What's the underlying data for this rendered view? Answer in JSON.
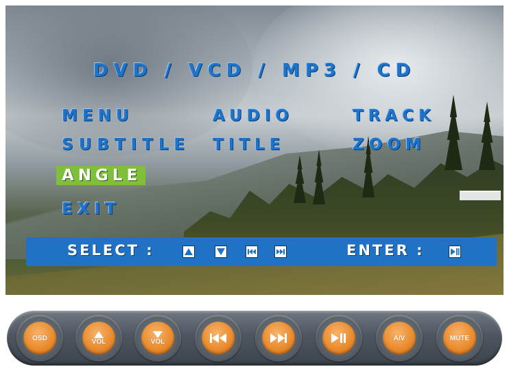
{
  "osd": {
    "title": "DVD / VCD / MP3 / CD",
    "items": {
      "menu": "MENU",
      "audio": "AUDIO",
      "track": "TRACK",
      "subtitle": "SUBTITLE",
      "title": "TITLE",
      "zoom": "ZOOM",
      "angle": "ANGLE",
      "exit": "EXIT"
    },
    "selected_item": "ANGLE",
    "highlight_color": "#7fbf3b",
    "text_color": "#1f73c9"
  },
  "select_bar": {
    "select_label": "SELECT :",
    "enter_label": "ENTER :",
    "keys": [
      "up-arrow-icon",
      "down-arrow-icon",
      "previous-icon",
      "next-icon"
    ],
    "enter_key": "play-pause-icon",
    "background": "#1f72c4"
  },
  "remote": {
    "buttons": [
      {
        "icon": "osd",
        "label": "OSD"
      },
      {
        "icon": "volume-up-icon",
        "label": "VOL"
      },
      {
        "icon": "volume-down-icon",
        "label": "VOL"
      },
      {
        "icon": "previous-icon",
        "label": ""
      },
      {
        "icon": "next-icon",
        "label": ""
      },
      {
        "icon": "play-pause-icon",
        "label": ""
      },
      {
        "icon": "av",
        "label": "A/V"
      },
      {
        "icon": "mute",
        "label": "MUTE"
      }
    ],
    "button_color": "#ea8c2f"
  }
}
